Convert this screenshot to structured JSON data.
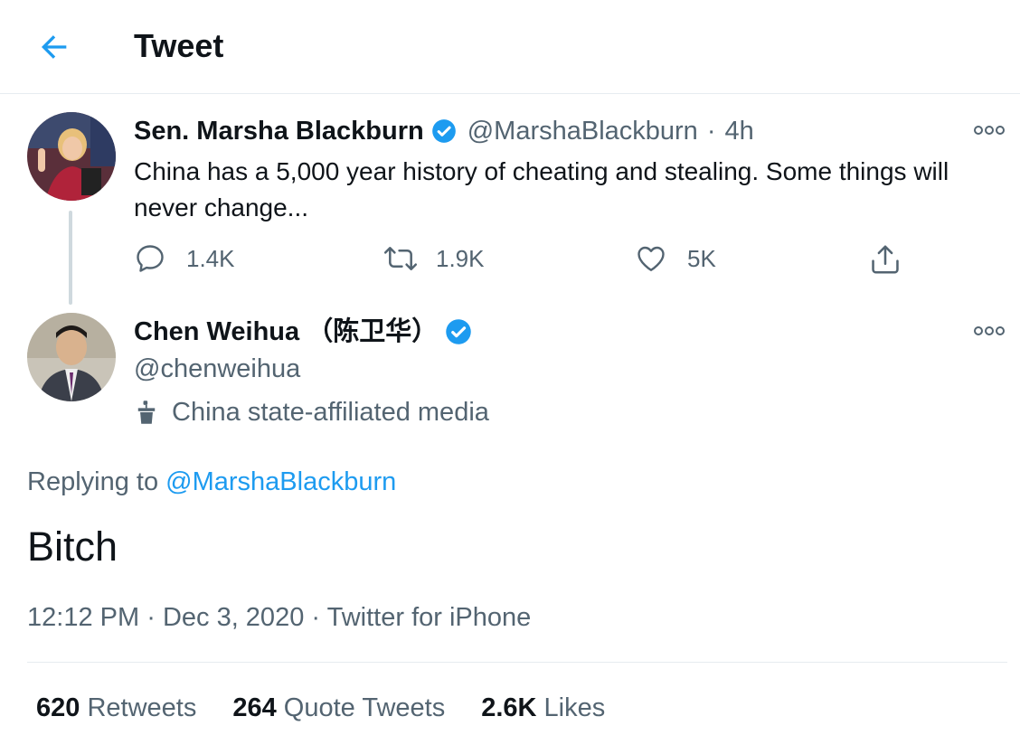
{
  "header": {
    "title": "Tweet",
    "back_icon": "arrow-left-icon"
  },
  "colors": {
    "accent": "#1d9bf0",
    "text": "#0f1419",
    "secondary": "#536471",
    "border": "#e6ecf0"
  },
  "parent_tweet": {
    "name": "Sen. Marsha Blackburn",
    "verified": true,
    "handle": "@MarshaBlackburn",
    "separator": "·",
    "time": "4h",
    "text": "China has a 5,000 year history of cheating and stealing. Some things will never change...",
    "actions": {
      "reply": {
        "icon": "reply-icon",
        "count": "1.4K"
      },
      "retweet": {
        "icon": "retweet-icon",
        "count": "1.9K"
      },
      "like": {
        "icon": "heart-icon",
        "count": "5K"
      },
      "share": {
        "icon": "share-icon"
      }
    }
  },
  "main_tweet": {
    "name": "Chen Weihua （陈卫华）",
    "verified": true,
    "handle": "@chenweihua",
    "label": "China state-affiliated media",
    "replying_prefix": "Replying to",
    "replying_to": "@MarshaBlackburn",
    "text": "Bitch",
    "time": "12:12 PM",
    "separator": "·",
    "date": "Dec 3, 2020",
    "source": "Twitter for iPhone"
  },
  "stats": [
    {
      "count": "620",
      "label": "Retweets"
    },
    {
      "count": "264",
      "label": "Quote Tweets"
    },
    {
      "count": "2.6K",
      "label": "Likes"
    }
  ]
}
